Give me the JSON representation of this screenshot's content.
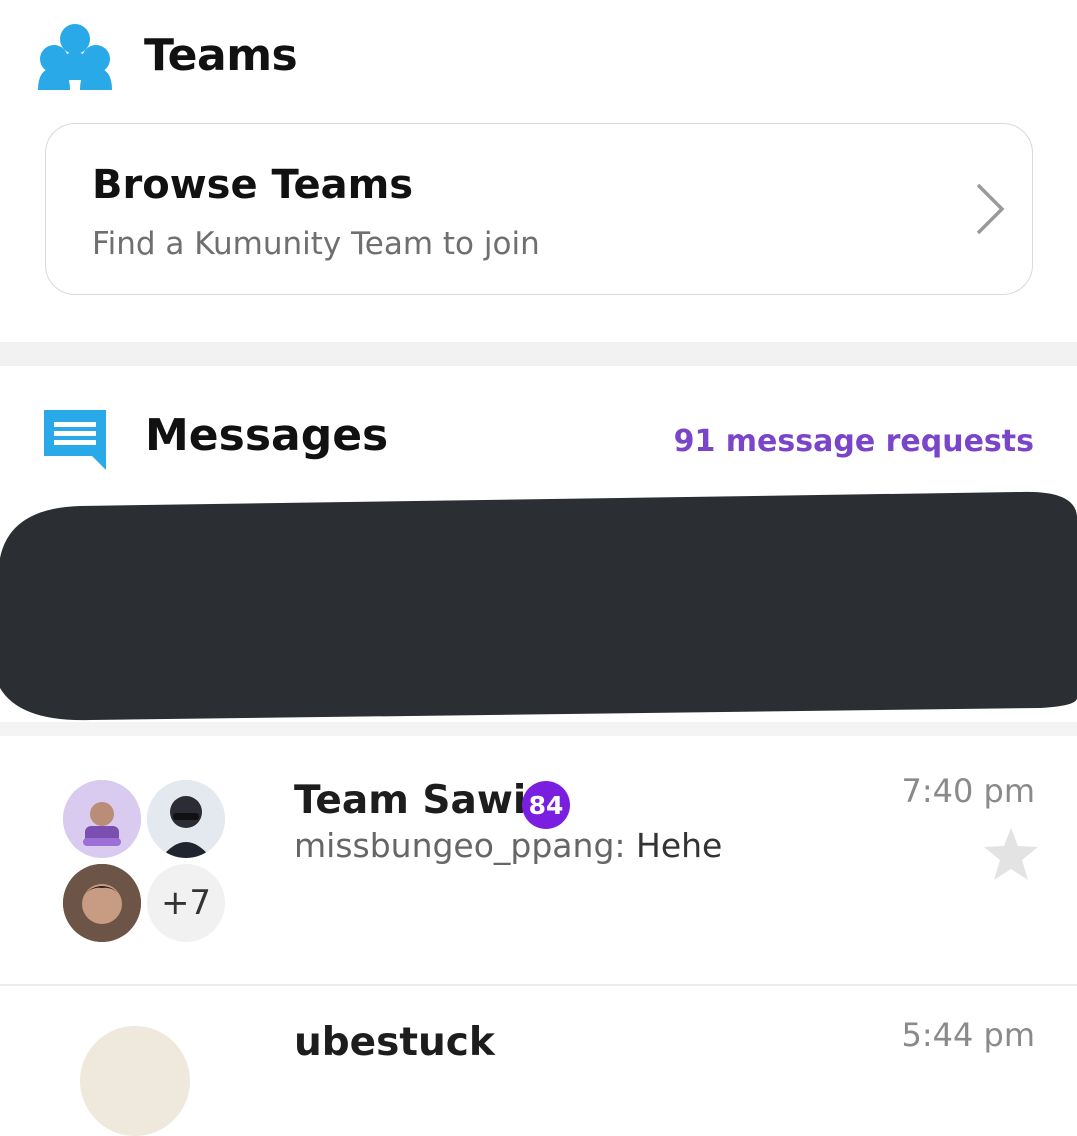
{
  "teams": {
    "title": "Teams",
    "icon": "teams-group-icon",
    "icon_color": "#29a9e8"
  },
  "browse": {
    "title": "Browse Teams",
    "subtitle": "Find a Kumunity Team to join"
  },
  "messages": {
    "title": "Messages",
    "requests_label": "91 message requests",
    "accent": "#7a45c9",
    "icon": "chat-bubble-icon",
    "icon_color": "#29a9e8"
  },
  "conversations": [
    {
      "name": "Team Sawi",
      "unread": "84",
      "sender": "missbungeo_ppang:",
      "message": "Hehe",
      "time": "7:40 pm",
      "more_members": "+7",
      "badge_color": "#7a1fe0"
    },
    {
      "name": "ubestuck",
      "time": "5:44 pm"
    }
  ]
}
